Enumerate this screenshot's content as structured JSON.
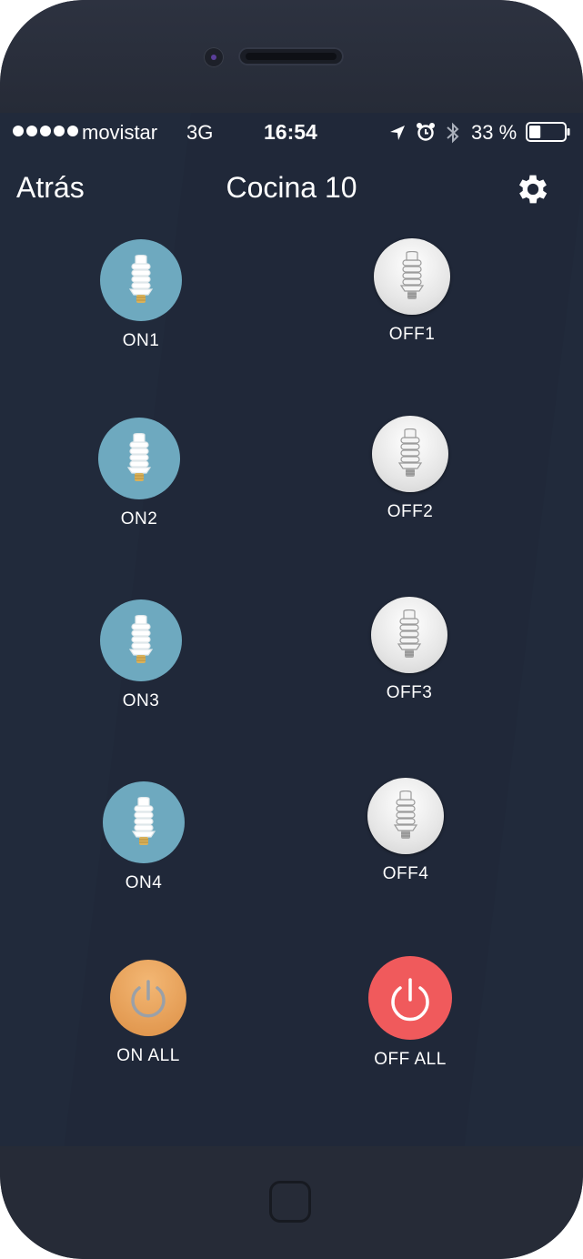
{
  "status": {
    "carrier": "movistar",
    "network": "3G",
    "time": "16:54",
    "battery": "33 %",
    "battery_level": 0.33
  },
  "nav": {
    "back_label": "Atrás",
    "title": "Cocina 10"
  },
  "lights": {
    "on": [
      "ON1",
      "ON2",
      "ON3",
      "ON4"
    ],
    "off": [
      "OFF1",
      "OFF2",
      "OFF3",
      "OFF4"
    ]
  },
  "all": {
    "on_label": "ON ALL",
    "off_label": "OFF ALL"
  },
  "colors": {
    "background": "#212a3b",
    "on_button": "#6ea9bf",
    "on_all": "#dd9046",
    "off_all": "#f05a5c"
  }
}
